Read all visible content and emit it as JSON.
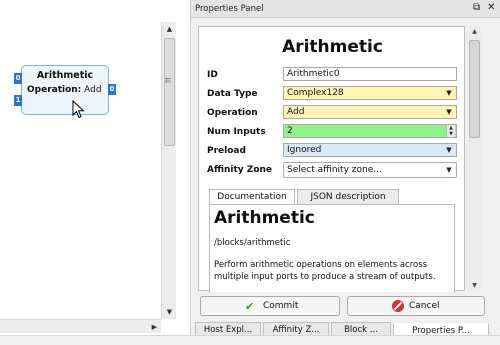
{
  "canvas": {
    "block": {
      "title": "Arithmetic",
      "op_label": "Operation:",
      "op_value": "Add",
      "in_ports": [
        "0",
        "1"
      ],
      "out_port": "0"
    }
  },
  "panel": {
    "title": "Properties Panel",
    "float_icon": "restore-icon",
    "close_icon": "close-icon",
    "block_name": "Arithmetic",
    "fields": {
      "id": {
        "label": "ID",
        "value": "Arithmetic0"
      },
      "data_type": {
        "label": "Data Type",
        "value": "Complex128"
      },
      "operation": {
        "label": "Operation",
        "value": "Add"
      },
      "num_inputs": {
        "label": "Num Inputs",
        "value": "2"
      },
      "preload": {
        "label": "Preload",
        "value": "Ignored"
      },
      "affinity_zone": {
        "label": "Affinity Zone",
        "value": "Select affinity zone..."
      }
    },
    "tabs": [
      "Documentation",
      "JSON description"
    ],
    "doc": {
      "title": "Arithmetic",
      "path": "/blocks/arithmetic",
      "text": "Perform arithmetic operations on elements across multiple input ports to produce a stream of outputs."
    },
    "buttons": {
      "commit": "Commit",
      "cancel": "Cancel"
    },
    "bottom_tabs": [
      "Host Expl...",
      "Affinity Z...",
      "Block ...",
      "Properties P..."
    ],
    "colors": {
      "data_type_bg": "#fff5b7",
      "num_inputs_bg": "#8ff28b",
      "preload_bg": "#dbe8f6",
      "port": "#2f73c8"
    }
  }
}
